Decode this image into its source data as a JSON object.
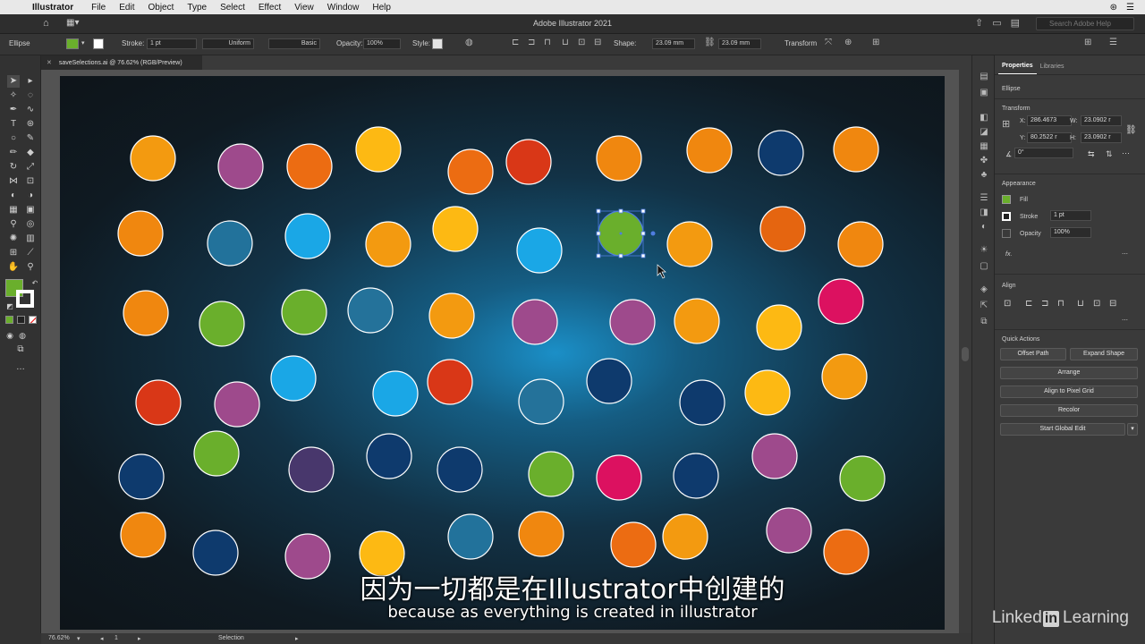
{
  "menubar": {
    "app": "Illustrator",
    "items": [
      "File",
      "Edit",
      "Object",
      "Type",
      "Select",
      "Effect",
      "View",
      "Window",
      "Help"
    ]
  },
  "appbar": {
    "title": "Adobe Illustrator 2021",
    "search_placeholder": "Search Adobe Help"
  },
  "controlbar": {
    "selection_type": "Ellipse",
    "stroke_label": "Stroke:",
    "stroke_weight": "1 pt",
    "profile": "Uniform",
    "brush": "Basic",
    "opacity_label": "Opacity:",
    "opacity": "100%",
    "style_label": "Style:",
    "shape_label": "Shape:",
    "width": "23.09 mm",
    "height": "23.09 mm",
    "transform_label": "Transform",
    "fill_color": "#6aaf2c"
  },
  "document": {
    "tab_title": "saveSelections.ai @ 76.62% (RGB/Preview)"
  },
  "statusbar": {
    "zoom": "76.62%",
    "artboard": "1",
    "tool": "Selection"
  },
  "panel": {
    "tabs": [
      "Properties",
      "Libraries"
    ],
    "object_type": "Ellipse",
    "transform": {
      "title": "Transform",
      "x_label": "X:",
      "x": "286.4673",
      "y_label": "Y:",
      "y": "80.2522 r",
      "w_label": "W:",
      "w": "23.0902 r",
      "h_label": "H:",
      "h": "23.0902 r",
      "angle": "0°"
    },
    "appearance": {
      "title": "Appearance",
      "fill_label": "Fill",
      "stroke_label": "Stroke",
      "stroke_weight": "1 pt",
      "opacity_label": "Opacity",
      "opacity": "100%",
      "fx": "fx."
    },
    "align": {
      "title": "Align"
    },
    "quick_actions": {
      "title": "Quick Actions",
      "offset_path": "Offset Path",
      "expand_shape": "Expand Shape",
      "arrange": "Arrange",
      "align_pixel": "Align to Pixel Grid",
      "recolor": "Recolor",
      "global_edit": "Start Global Edit"
    }
  },
  "subtitles": {
    "zh": "因为一切都是在Illustrator中创建的",
    "en": "because as everything is created in illustrator"
  },
  "watermark": {
    "brand": "Linked",
    "in": "in",
    "brand2": "Learning"
  },
  "circles": [
    {
      "c": "#f39a10"
    },
    {
      "c": "#9e4a8c"
    },
    {
      "c": "#ec6c12"
    },
    {
      "c": "#fdb913"
    },
    {
      "c": "#ec6c12"
    },
    {
      "c": "#d93717"
    },
    {
      "c": "#f0870f"
    },
    {
      "c": "#f0870f"
    },
    {
      "c": "#0e3a6d"
    },
    {
      "c": "#f0870f"
    },
    {
      "c": "#f0870f"
    },
    {
      "c": "#22729b"
    },
    {
      "c": "#1aa7e6"
    },
    {
      "c": "#f39a10"
    },
    {
      "c": "#fdb913"
    },
    {
      "c": "#1aa7e6"
    },
    {
      "c": "#6aaf2c",
      "selected": true
    },
    {
      "c": "#f39a10"
    },
    {
      "c": "#e56510"
    },
    {
      "c": "#f0870f"
    },
    {
      "c": "#f0870f"
    },
    {
      "c": "#6aaf2c"
    },
    {
      "c": "#6aaf2c"
    },
    {
      "c": "#24729a"
    },
    {
      "c": "#f39a10"
    },
    {
      "c": "#9e4a8c"
    },
    {
      "c": "#9e4a8c"
    },
    {
      "c": "#f39a10"
    },
    {
      "c": "#fdb913"
    },
    {
      "c": "#dc1160"
    },
    {
      "c": "#d93717"
    },
    {
      "c": "#9e4a8c"
    },
    {
      "c": "#1aa7e6"
    },
    {
      "c": "#1aa7e6"
    },
    {
      "c": "#d93717"
    },
    {
      "c": "#24729a"
    },
    {
      "c": "#0e3a6d"
    },
    {
      "c": "#0e3a6d"
    },
    {
      "c": "#fdb913"
    },
    {
      "c": "#f39a10"
    },
    {
      "c": "#0e3a6d"
    },
    {
      "c": "#6aaf2c"
    },
    {
      "c": "#48376c"
    },
    {
      "c": "#0e3a6d"
    },
    {
      "c": "#0e3a6d"
    },
    {
      "c": "#6aaf2c"
    },
    {
      "c": "#dc1160"
    },
    {
      "c": "#0e3a6d"
    },
    {
      "c": "#9e4a8c"
    },
    {
      "c": "#6aaf2c"
    },
    {
      "c": "#f0870f"
    },
    {
      "c": "#0e3a6d"
    },
    {
      "c": "#9e4a8c"
    },
    {
      "c": "#fdb913"
    },
    {
      "c": "#22729b"
    },
    {
      "c": "#f0870f"
    },
    {
      "c": "#ec6c12"
    },
    {
      "c": "#f39a10"
    },
    {
      "c": "#9e4a8c"
    },
    {
      "c": "#ec6c12"
    }
  ]
}
